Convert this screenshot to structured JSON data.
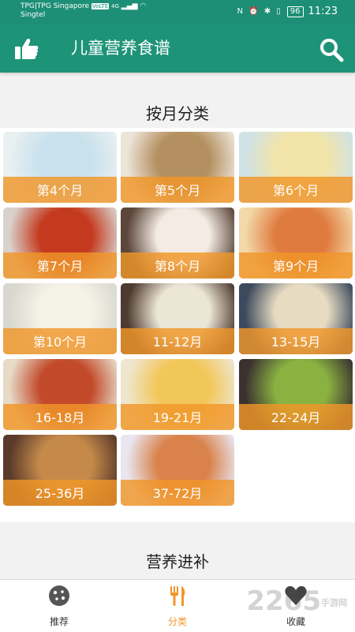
{
  "status_bar": {
    "carrier_line1": "TPG|TPG Singapore",
    "carrier_badge": "VoLTE",
    "network": "4G",
    "carrier_line2": "Singtel",
    "battery": "96",
    "time": "11:23"
  },
  "app_bar": {
    "title": "儿童营养食谱",
    "left_icon": "thumbs-up-icon",
    "right_icon": "search-icon"
  },
  "sections": {
    "by_month_title": "按月分类",
    "nutrition_title": "营养进补"
  },
  "tiles": [
    {
      "label": "第4个月",
      "colors": [
        "#c9e1ec",
        "#e9f0f2"
      ]
    },
    {
      "label": "第5个月",
      "colors": [
        "#b48f5f",
        "#ece5d8"
      ]
    },
    {
      "label": "第6个月",
      "colors": [
        "#f2e4a8",
        "#cfe2e6"
      ]
    },
    {
      "label": "第7个月",
      "colors": [
        "#c43a1e",
        "#d9d1cc"
      ]
    },
    {
      "label": "第8个月",
      "colors": [
        "#f4ece4",
        "#5c463a"
      ]
    },
    {
      "label": "第9个月",
      "colors": [
        "#e07b3f",
        "#f3d9a9"
      ]
    },
    {
      "label": "第10个月",
      "colors": [
        "#f5f2e6",
        "#d9d8cf"
      ]
    },
    {
      "label": "11-12月",
      "colors": [
        "#ece6d6",
        "#4e3a2f"
      ]
    },
    {
      "label": "13-15月",
      "colors": [
        "#e7dcc2",
        "#3d4a5d"
      ]
    },
    {
      "label": "16-18月",
      "colors": [
        "#c24a2a",
        "#e7dac7"
      ]
    },
    {
      "label": "19-21月",
      "colors": [
        "#f2c75a",
        "#efe6cf"
      ]
    },
    {
      "label": "22-24月",
      "colors": [
        "#8bb241",
        "#3b3230"
      ]
    },
    {
      "label": "25-36月",
      "colors": [
        "#c58a4a",
        "#5a3a2a"
      ]
    },
    {
      "label": "37-72月",
      "colors": [
        "#d9824b",
        "#e9e6f0"
      ]
    }
  ],
  "bottom_nav": [
    {
      "label": "推荐",
      "icon": "cookie-icon",
      "active": false
    },
    {
      "label": "分类",
      "icon": "fork-knife-icon",
      "active": true
    },
    {
      "label": "收藏",
      "icon": "heart-icon",
      "active": false
    }
  ],
  "watermark": {
    "text": "2265",
    "sub": "手游网"
  },
  "colors": {
    "primary": "#1d9378",
    "accent": "#f0962a"
  }
}
